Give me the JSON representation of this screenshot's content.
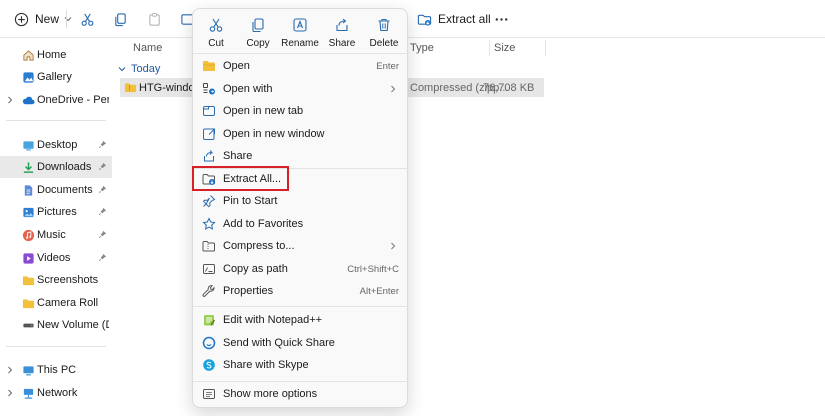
{
  "toolbar": {
    "new_label": "New",
    "extract_all_label": "Extract all"
  },
  "sidebar": {
    "home": "Home",
    "gallery": "Gallery",
    "onedrive": "OneDrive - Persona",
    "desktop": "Desktop",
    "downloads": "Downloads",
    "documents": "Documents",
    "pictures": "Pictures",
    "music": "Music",
    "videos": "Videos",
    "screenshots": "Screenshots",
    "camera_roll": "Camera Roll",
    "new_volume": "New Volume (D:)",
    "this_pc": "This PC",
    "network": "Network"
  },
  "content": {
    "columns": {
      "name": "Name",
      "type": "Type",
      "size": "Size"
    },
    "group_label": "Today",
    "file": {
      "name": "HTG-windows",
      "type": "Compressed (zipp...",
      "size": "76,708 KB"
    }
  },
  "context_menu": {
    "quick_actions": {
      "cut": "Cut",
      "copy": "Copy",
      "rename": "Rename",
      "share": "Share",
      "delete": "Delete"
    },
    "items": {
      "open": {
        "label": "Open",
        "shortcut": "Enter"
      },
      "open_with": {
        "label": "Open with"
      },
      "open_new_tab": {
        "label": "Open in new tab"
      },
      "open_new_window": {
        "label": "Open in new window"
      },
      "share": {
        "label": "Share"
      },
      "extract_all": {
        "label": "Extract All..."
      },
      "pin_to_start": {
        "label": "Pin to Start"
      },
      "add_to_favorites": {
        "label": "Add to Favorites"
      },
      "compress_to": {
        "label": "Compress to..."
      },
      "copy_as_path": {
        "label": "Copy as path",
        "shortcut": "Ctrl+Shift+C"
      },
      "properties": {
        "label": "Properties",
        "shortcut": "Alt+Enter"
      },
      "edit_notepad": {
        "label": "Edit with Notepad++"
      },
      "quick_share": {
        "label": "Send with Quick Share"
      },
      "share_skype": {
        "label": "Share with Skype"
      },
      "show_more": {
        "label": "Show more options"
      }
    }
  },
  "colors": {
    "accent_blue": "#1a73c9",
    "folder_yellow": "#f3c03c",
    "highlight_red": "#d61f26",
    "selection_gray": "#e6e6e6"
  }
}
